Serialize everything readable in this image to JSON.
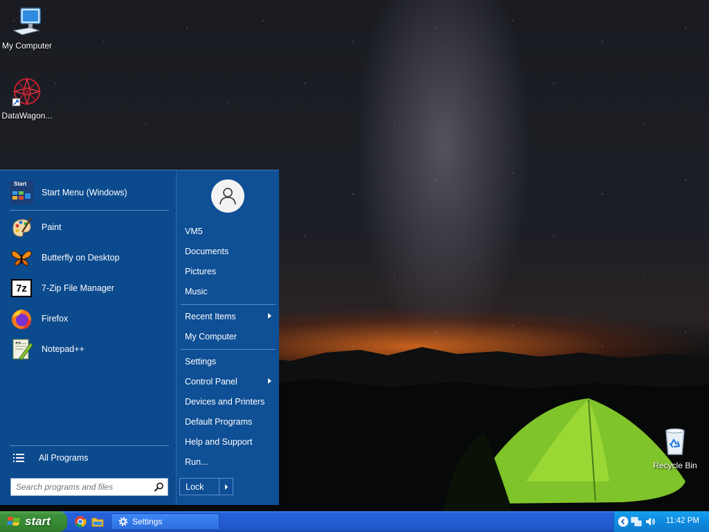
{
  "desktop": {
    "icons": [
      {
        "label": "My Computer"
      },
      {
        "label": "DataWagon..."
      },
      {
        "label": "Recycle Bin"
      }
    ]
  },
  "start_menu": {
    "pinned": {
      "label": "Start Menu (Windows)",
      "badge": "Start"
    },
    "programs": [
      {
        "label": "Paint",
        "icon": "paint-icon"
      },
      {
        "label": "Butterfly on Desktop",
        "icon": "butterfly-icon"
      },
      {
        "label": "7-Zip File Manager",
        "icon": "7zip-icon",
        "badge": "7z"
      },
      {
        "label": "Firefox",
        "icon": "firefox-icon"
      },
      {
        "label": "Notepad++",
        "icon": "notepad-plus-plus-icon"
      }
    ],
    "all_programs": "All Programs",
    "search": {
      "placeholder": "Search programs and files",
      "value": ""
    },
    "right": {
      "user": "VM5",
      "items": [
        {
          "label": "Documents"
        },
        {
          "label": "Pictures"
        },
        {
          "label": "Music"
        },
        {
          "label": "Recent Items",
          "submenu": true
        },
        {
          "label": "My Computer"
        },
        {
          "label": "Settings"
        },
        {
          "label": "Control Panel",
          "submenu": true
        },
        {
          "label": "Devices and Printers"
        },
        {
          "label": "Default Programs"
        },
        {
          "label": "Help and Support"
        },
        {
          "label": "Run..."
        }
      ],
      "lock": "Lock"
    }
  },
  "taskbar": {
    "start_label": "start",
    "tasks": [
      {
        "label": "Settings",
        "icon": "gear-icon"
      }
    ],
    "clock": "11:42 PM"
  },
  "colors": {
    "menu_left": "#0c4a8e",
    "menu_right": "#0e4f95",
    "taskbar": "#245ed4",
    "start_button": "#378a34",
    "tray": "#0d8ae0"
  }
}
